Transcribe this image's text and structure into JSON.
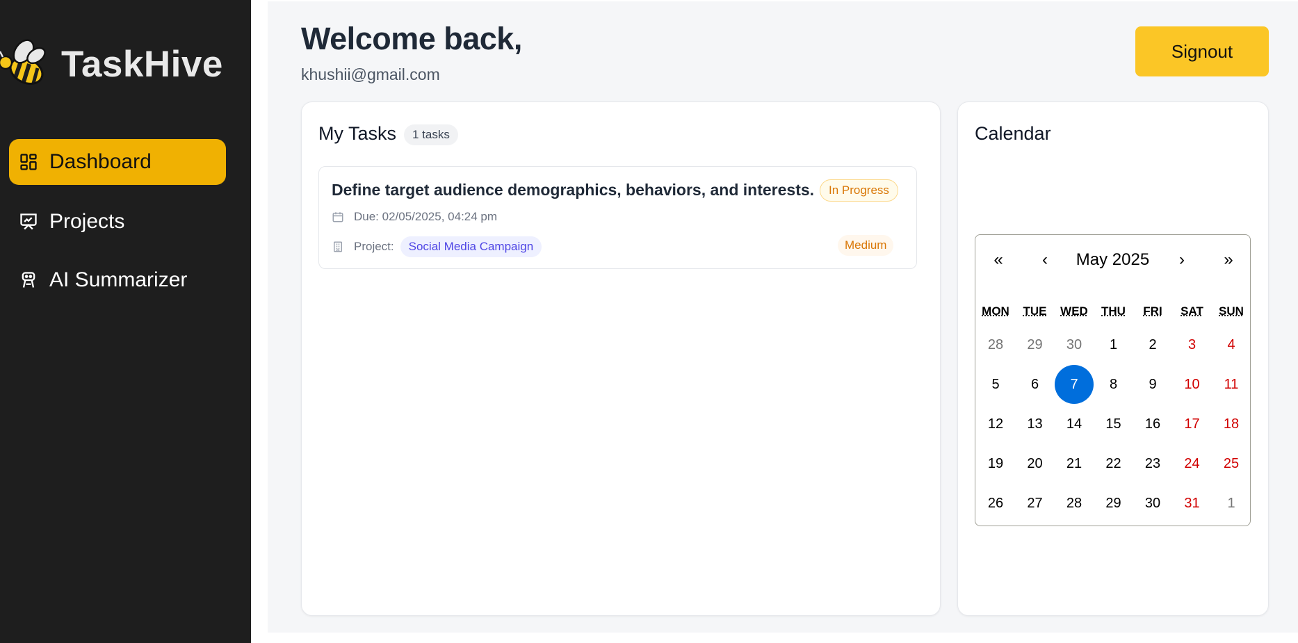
{
  "brand": {
    "name": "TaskHive",
    "logo_icon": "bee-icon"
  },
  "sidebar": {
    "items": [
      {
        "label": "Dashboard",
        "icon": "dashboard-grid-icon",
        "active": true
      },
      {
        "label": "Projects",
        "icon": "presentation-chart-icon",
        "active": false
      },
      {
        "label": "AI Summarizer",
        "icon": "robot-icon",
        "active": false
      }
    ]
  },
  "header": {
    "welcome": "Welcome back,",
    "email": "khushii@gmail.com",
    "signout_label": "Signout"
  },
  "tasks": {
    "title": "My Tasks",
    "count_label": "1 tasks",
    "items": [
      {
        "title": "Define target audience demographics, behaviors, and interests.",
        "status": "In Progress",
        "due": "Due: 02/05/2025, 04:24 pm",
        "project_label": "Project:",
        "project": "Social Media Campaign",
        "priority": "Medium"
      }
    ]
  },
  "calendar": {
    "title": "Calendar",
    "nav": {
      "prev_year": "«",
      "prev_month": "‹",
      "next_month": "›",
      "next_year": "»"
    },
    "month_label": "May 2025",
    "weekdays": [
      "MON",
      "TUE",
      "WED",
      "THU",
      "FRI",
      "SAT",
      "SUN"
    ],
    "weeks": [
      [
        "28",
        "29",
        "30",
        "1",
        "2",
        "3",
        "4"
      ],
      [
        "5",
        "6",
        "7",
        "8",
        "9",
        "10",
        "11"
      ],
      [
        "12",
        "13",
        "14",
        "15",
        "16",
        "17",
        "18"
      ],
      [
        "19",
        "20",
        "21",
        "22",
        "23",
        "24",
        "25"
      ],
      [
        "26",
        "27",
        "28",
        "29",
        "30",
        "31",
        "1"
      ]
    ],
    "selected_day": "7",
    "colors": {
      "selected": "#006edc",
      "weekend": "#d10000",
      "other_month": "#757575"
    }
  },
  "colors": {
    "accent": "#f0b102",
    "signout": "#fbc626",
    "sidebar_bg": "#1e1e1e"
  }
}
